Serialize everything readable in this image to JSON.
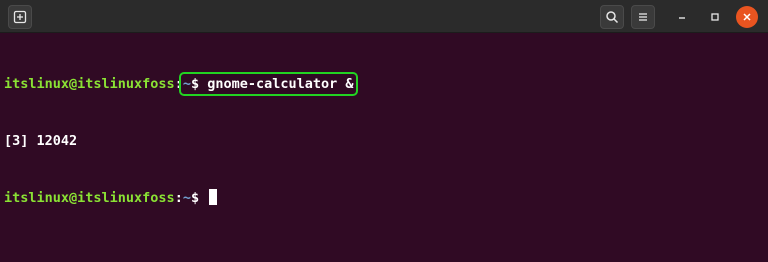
{
  "titlebar": {
    "icons": {
      "new_tab": "new-tab-icon",
      "search": "search-icon",
      "menu": "hamburger-menu-icon",
      "minimize": "minimize-icon",
      "maximize": "maximize-icon",
      "close": "close-icon"
    }
  },
  "terminal": {
    "colors": {
      "background": "#300a24",
      "user_host": "#8ae234",
      "path": "#729fcf",
      "text": "#ffffff",
      "highlight_box": "#22d322",
      "close_button": "#e95420"
    },
    "lines": [
      {
        "user_host": "itslinux@itslinuxfoss",
        "colon": ":",
        "path": "~",
        "prompt": "$ ",
        "command": "gnome-calculator &"
      },
      {
        "output": "[3] 12042"
      },
      {
        "user_host": "itslinux@itslinuxfoss",
        "colon": ":",
        "path": "~",
        "prompt": "$ "
      }
    ]
  }
}
